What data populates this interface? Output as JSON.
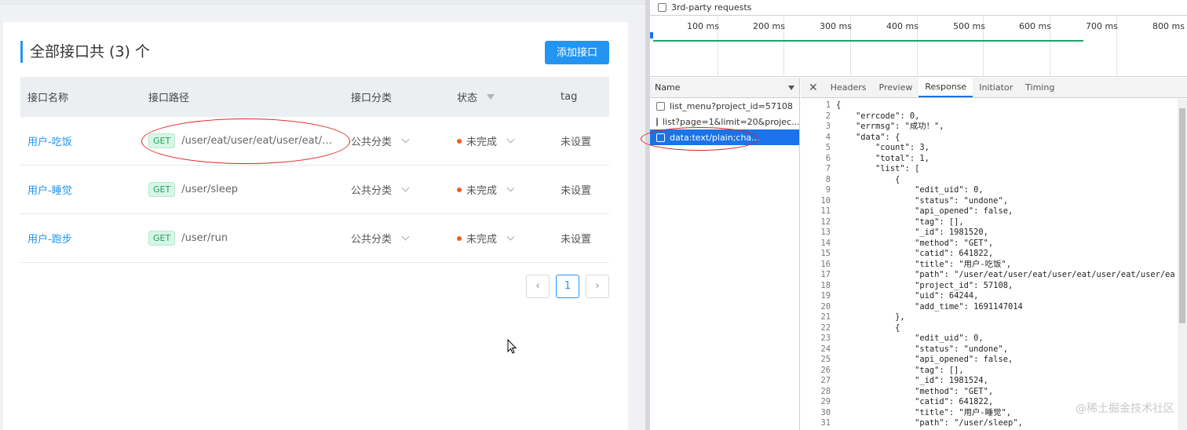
{
  "app": {
    "title": "全部接口共 (3) 个",
    "add_button": "添加接口",
    "columns": [
      "接口名称",
      "接口路径",
      "接口分类",
      "状态",
      "tag"
    ],
    "rows": [
      {
        "name": "用户-吃饭",
        "method": "GET",
        "path": "/user/eat/user/eat/user/eat/user/e...",
        "category": "公共分类",
        "status": "未完成",
        "tag": "未设置"
      },
      {
        "name": "用户-睡觉",
        "method": "GET",
        "path": "/user/sleep",
        "category": "公共分类",
        "status": "未完成",
        "tag": "未设置"
      },
      {
        "name": "用户-跑步",
        "method": "GET",
        "path": "/user/run",
        "category": "公共分类",
        "status": "未完成",
        "tag": "未设置"
      }
    ],
    "pager": {
      "current": "1"
    }
  },
  "devtools": {
    "third_party_label": "3rd-party requests",
    "timeline_ticks": [
      "100 ms",
      "200 ms",
      "300 ms",
      "400 ms",
      "500 ms",
      "600 ms",
      "700 ms",
      "800 ms"
    ],
    "name_header": "Name",
    "requests": [
      {
        "label": "list_menu?project_id=57108",
        "selected": false
      },
      {
        "label": "list?page=1&limit=20&projec...",
        "selected": false
      },
      {
        "label": "data:text/plain;cha...",
        "selected": true
      }
    ],
    "tabs": [
      "Headers",
      "Preview",
      "Response",
      "Initiator",
      "Timing"
    ],
    "active_tab": "Response",
    "response_lines": [
      "{",
      "    \"errcode\": 0,",
      "    \"errmsg\": \"成功！\",",
      "    \"data\": {",
      "        \"count\": 3,",
      "        \"total\": 1,",
      "        \"list\": [",
      "            {",
      "                \"edit_uid\": 0,",
      "                \"status\": \"undone\",",
      "                \"api_opened\": false,",
      "                \"tag\": [],",
      "                \"_id\": 1981520,",
      "                \"method\": \"GET\",",
      "                \"catid\": 641822,",
      "                \"title\": \"用户-吃饭\",",
      "                \"path\": \"/user/eat/user/eat/user/eat/user/eat/user/ea",
      "                \"project_id\": 57108,",
      "                \"uid\": 64244,",
      "                \"add_time\": 1691147014",
      "            },",
      "            {",
      "                \"edit_uid\": 0,",
      "                \"status\": \"undone\",",
      "                \"api_opened\": false,",
      "                \"tag\": [],",
      "                \"_id\": 1981524,",
      "                \"method\": \"GET\",",
      "                \"catid\": 641822,",
      "                \"title\": \"用户-睡觉\",",
      "                \"path\": \"/user/sleep\","
    ]
  },
  "watermark": "@稀土掘金技术社区",
  "colors": {
    "accent": "#2395f1",
    "devtools_blue": "#1a73e8",
    "status_dot": "#f55b1e",
    "get_green": "#1ba45a",
    "annotation_red": "#e02020"
  }
}
